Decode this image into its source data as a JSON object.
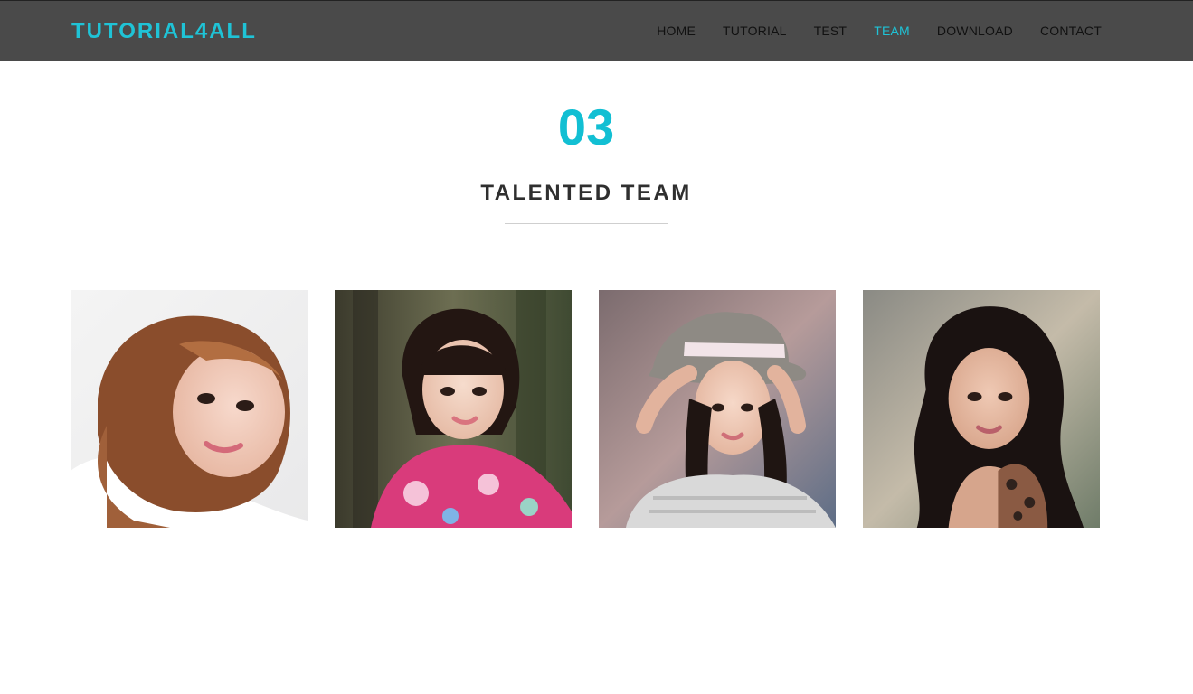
{
  "header": {
    "brand": "TUTORIAL4ALL",
    "nav": [
      {
        "label": "HOME",
        "active": false
      },
      {
        "label": "TUTORIAL",
        "active": false
      },
      {
        "label": "TEST",
        "active": false
      },
      {
        "label": "TEAM",
        "active": true
      },
      {
        "label": "DOWNLOAD",
        "active": false
      },
      {
        "label": "CONTACT",
        "active": false
      }
    ]
  },
  "section": {
    "number": "03",
    "title": "TALENTED TEAM"
  },
  "team": {
    "members": [
      {
        "photo": "team-member-photo-1"
      },
      {
        "photo": "team-member-photo-2"
      },
      {
        "photo": "team-member-photo-3"
      },
      {
        "photo": "team-member-photo-4"
      }
    ]
  },
  "colors": {
    "accent": "#1fc3d6",
    "header_bg": "#4a4a4a",
    "title_text": "#2f2f2f",
    "nav_text": "#111111"
  }
}
